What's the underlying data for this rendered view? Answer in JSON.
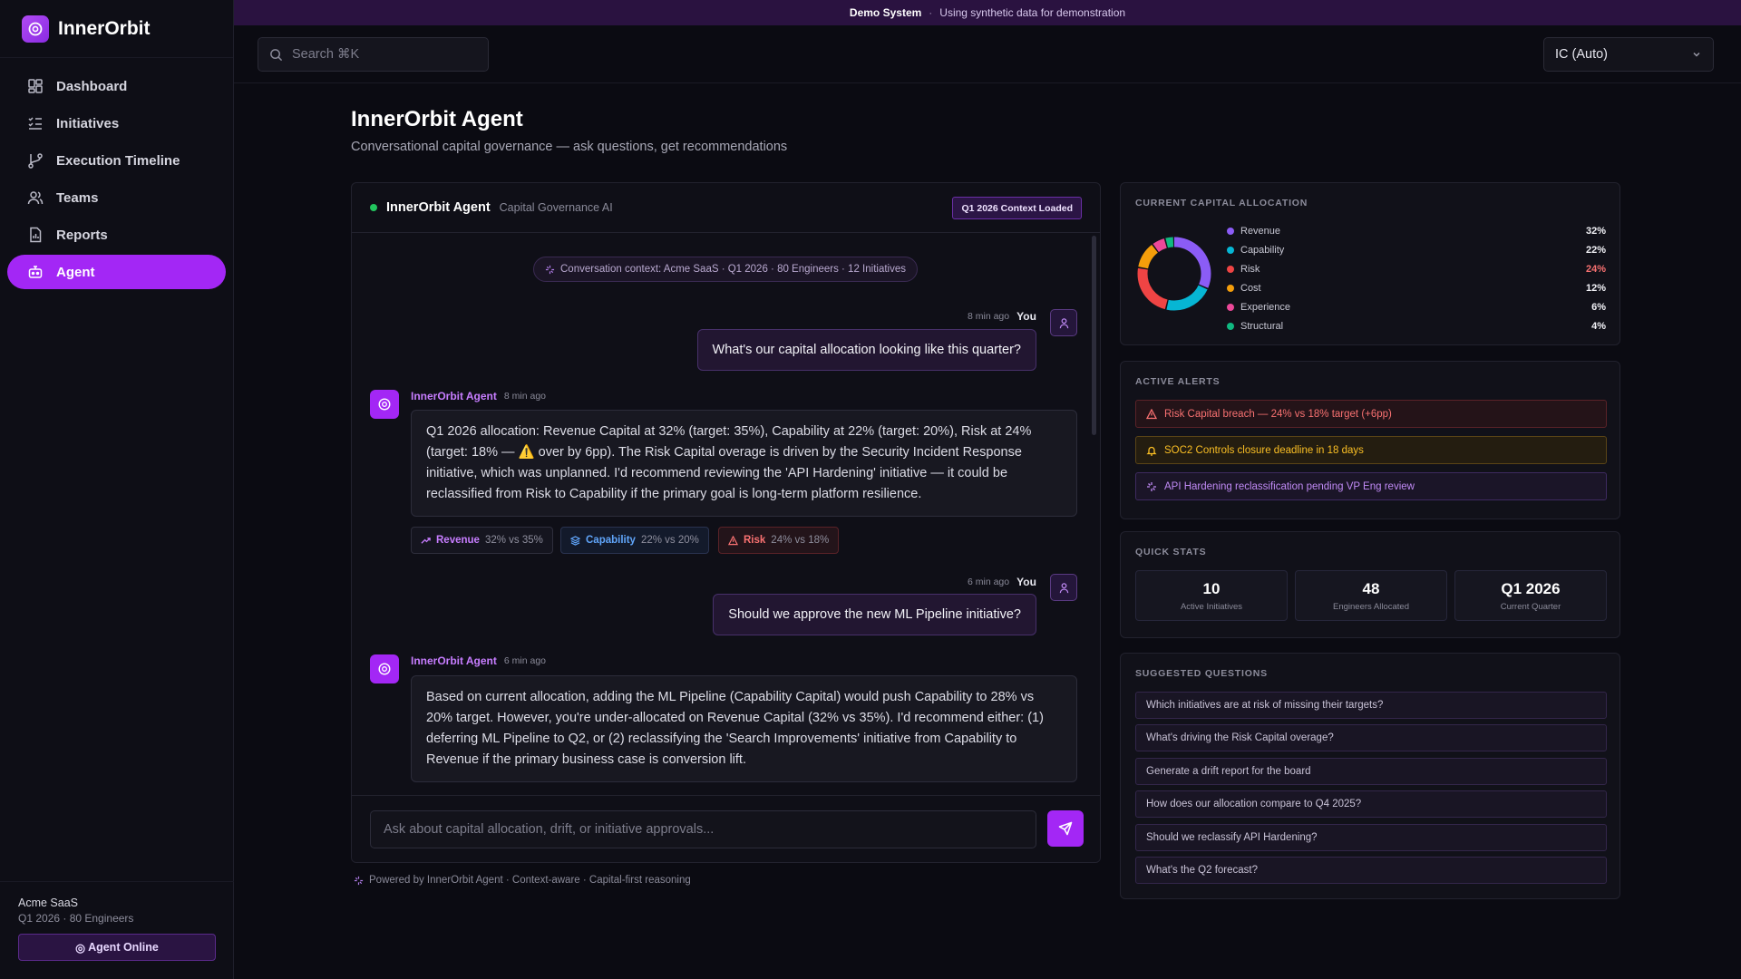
{
  "brand": {
    "name": "InnerOrbit"
  },
  "banner": {
    "title": "Demo System",
    "separator": "·",
    "text": "Using synthetic data for demonstration"
  },
  "nav": [
    {
      "label": "Dashboard",
      "icon": "dashboard-icon"
    },
    {
      "label": "Initiatives",
      "icon": "checklist-icon"
    },
    {
      "label": "Execution Timeline",
      "icon": "branch-icon"
    },
    {
      "label": "Teams",
      "icon": "users-icon"
    },
    {
      "label": "Reports",
      "icon": "report-icon"
    },
    {
      "label": "Agent",
      "icon": "bot-icon",
      "active": true
    }
  ],
  "footer": {
    "org": "Acme SaaS",
    "org_sub": "Q1 2026 · 80 Engineers",
    "status": "Agent Online",
    "status_glyph": "◎"
  },
  "topbar": {
    "search_placeholder": "Search ⌘K",
    "role": "IC (Auto)"
  },
  "page": {
    "title": "InnerOrbit Agent",
    "subtitle": "Conversational capital governance — ask questions, get recommendations"
  },
  "chat": {
    "title": "InnerOrbit Agent",
    "subtitle": "Capital Governance AI",
    "context_badge": "Q1 2026 Context Loaded",
    "context_pill": "Conversation context: Acme SaaS · Q1 2026 · 80 Engineers · 12 Initiatives",
    "messages": [
      {
        "role": "user",
        "author": "You",
        "time": "8 min ago",
        "text": "What's our capital allocation looking like this quarter?"
      },
      {
        "role": "agent",
        "author": "InnerOrbit Agent",
        "time": "8 min ago",
        "text": "Q1 2026 allocation: Revenue Capital at 32% (target: 35%), Capability at 22% (target: 20%), Risk at 24% (target: 18% — ⚠️ over by 6pp). The Risk Capital overage is driven by the Security Incident Response initiative, which was unplanned. I'd recommend reviewing the 'API Hardening' initiative — it could be reclassified from Risk to Capability if the primary goal is long-term platform resilience.",
        "tags": [
          {
            "label": "Revenue",
            "value": "32% vs 35%"
          },
          {
            "label": "Capability",
            "value": "22% vs 20%"
          },
          {
            "label": "Risk",
            "value": "24% vs 18%"
          }
        ]
      },
      {
        "role": "user",
        "author": "You",
        "time": "6 min ago",
        "text": "Should we approve the new ML Pipeline initiative?"
      },
      {
        "role": "agent",
        "author": "InnerOrbit Agent",
        "time": "6 min ago",
        "text": "Based on current allocation, adding the ML Pipeline (Capability Capital) would push Capability to 28% vs 20% target. However, you're under-allocated on Revenue Capital (32% vs 35%). I'd recommend either: (1) deferring ML Pipeline to Q2, or (2) reclassifying the 'Search Improvements' initiative from Capability to Revenue if the primary business case is conversion lift."
      }
    ],
    "input_placeholder": "Ask about capital allocation, drift, or initiative approvals...",
    "powered_by": "Powered by InnerOrbit Agent · Context-aware · Capital-first reasoning"
  },
  "allocation": {
    "title": "CURRENT CAPITAL ALLOCATION",
    "items": [
      {
        "label": "Revenue",
        "pct": "32%",
        "value": 32,
        "color": "#8b5cf6"
      },
      {
        "label": "Capability",
        "pct": "22%",
        "value": 22,
        "color": "#06b6d4"
      },
      {
        "label": "Risk",
        "pct": "24%",
        "value": 24,
        "color": "#ef4444",
        "alert": true
      },
      {
        "label": "Cost",
        "pct": "12%",
        "value": 12,
        "color": "#f59e0b"
      },
      {
        "label": "Experience",
        "pct": "6%",
        "value": 6,
        "color": "#ec4899"
      },
      {
        "label": "Structural",
        "pct": "4%",
        "value": 4,
        "color": "#10b981"
      }
    ]
  },
  "alerts": {
    "title": "ACTIVE ALERTS",
    "items": [
      {
        "text": "Risk Capital breach — 24% vs 18% target (+6pp)",
        "severity": "red",
        "icon": "warning-icon"
      },
      {
        "text": "SOC2 Controls closure deadline in 18 days",
        "severity": "amber",
        "icon": "bell-icon"
      },
      {
        "text": "API Hardening reclassification pending VP Eng review",
        "severity": "purple",
        "icon": "sparkle-icon"
      }
    ]
  },
  "quick_stats": {
    "title": "QUICK STATS",
    "items": [
      {
        "value": "10",
        "label": "Active Initiatives"
      },
      {
        "value": "48",
        "label": "Engineers Allocated"
      },
      {
        "value": "Q1 2026",
        "label": "Current Quarter"
      }
    ]
  },
  "suggested": {
    "title": "SUGGESTED QUESTIONS",
    "items": [
      "Which initiatives are at risk of missing their targets?",
      "What's driving the Risk Capital overage?",
      "Generate a drift report for the board",
      "How does our allocation compare to Q4 2025?",
      "Should we reclassify API Hardening?",
      "What's the Q2 forecast?"
    ]
  }
}
